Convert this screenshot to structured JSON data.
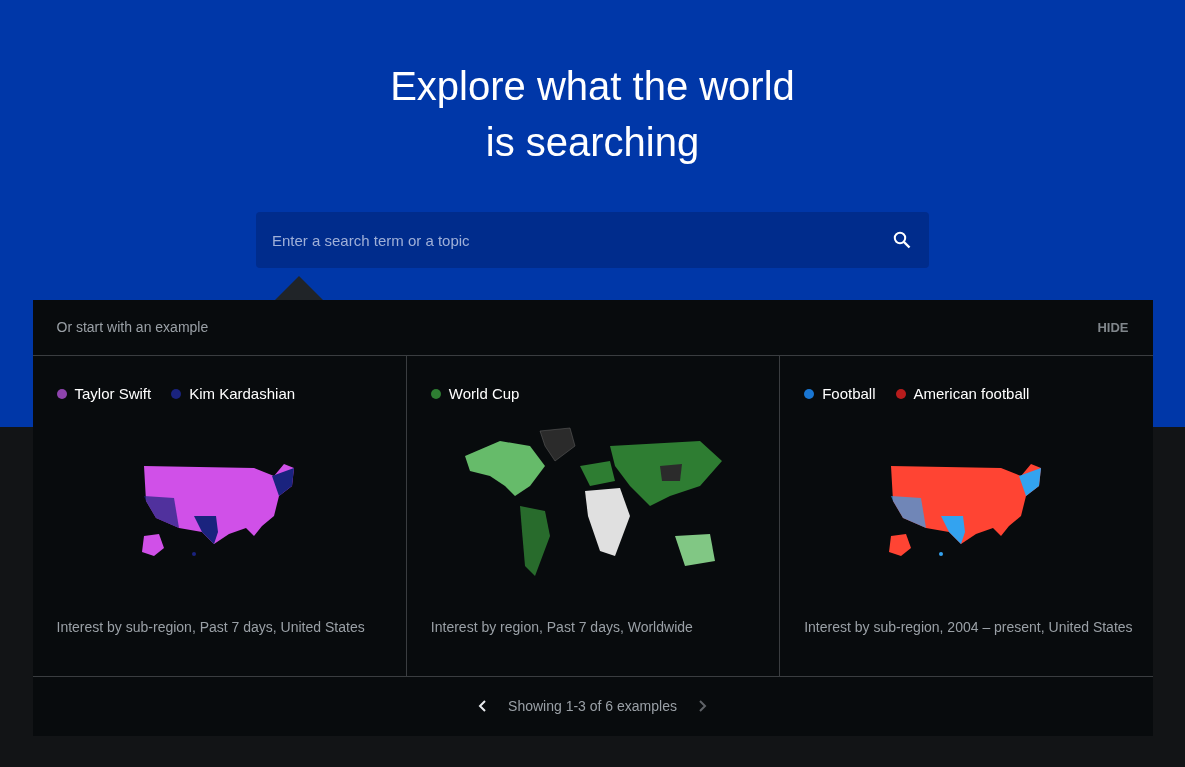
{
  "hero": {
    "title_lines": [
      "Explore what the world",
      "is searching"
    ]
  },
  "search": {
    "placeholder": "Enter a search term or a topic"
  },
  "examples": {
    "heading": "Or start with an example",
    "hide_button": "HIDE",
    "cards": [
      {
        "kind": "us",
        "legend": [
          {
            "label": "Taylor Swift",
            "color": "#8e44ad"
          },
          {
            "label": "Kim Kardashian",
            "color": "#1a237e"
          }
        ],
        "caption": "Interest by sub-region, Past 7 days, United States"
      },
      {
        "kind": "world",
        "legend": [
          {
            "label": "World Cup",
            "color": "#2e7d32"
          }
        ],
        "caption": "Interest by region, Past 7 days, Worldwide"
      },
      {
        "kind": "us",
        "legend": [
          {
            "label": "Football",
            "color": "#1976d2"
          },
          {
            "label": "American football",
            "color": "#b71c1c"
          }
        ],
        "caption": "Interest by sub-region, 2004 – present, United States"
      }
    ],
    "pager": {
      "text": "Showing 1-3 of 6 examples",
      "prev_disabled": false,
      "next_disabled": true
    }
  }
}
